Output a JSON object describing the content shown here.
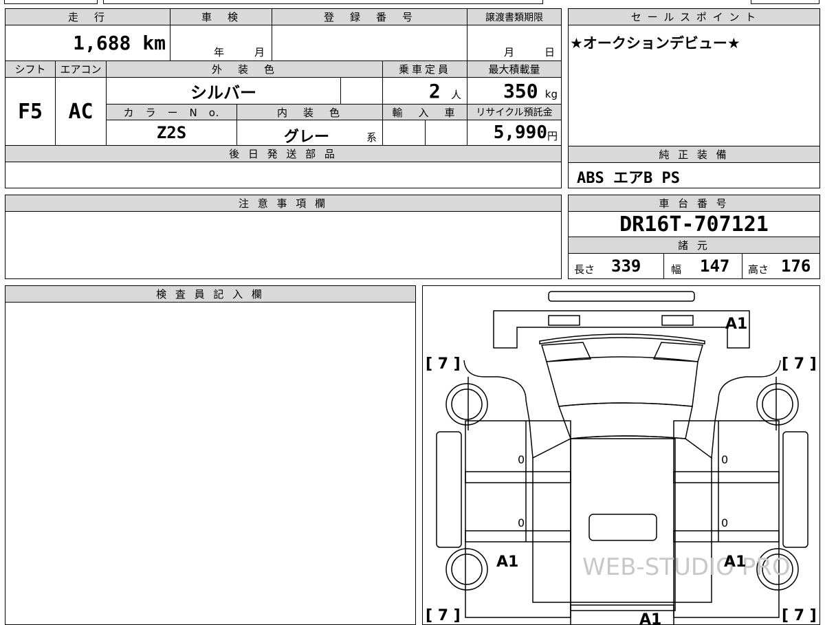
{
  "headers": {
    "mileage": "走　行",
    "inspection": "車　検",
    "registration": "登　録　番　号",
    "transfer_deadline": "譲渡書類期限",
    "sales_point": "セ ー ル ス ポ イ ン ト",
    "shift": "シフト",
    "aircon": "エアコン",
    "exterior_color": "外　装　色",
    "capacity": "乗車定員",
    "max_load": "最大積載量",
    "color_no": "カ　ラ　ー　N　o.",
    "interior_color": "内　装　色",
    "import": "輸　入　車",
    "recycle_fee": "リサイクル預託金",
    "later_parts": "後 日 発 送 部 品",
    "genuine_equipment": "純 正 装 備",
    "notes": "注 意 事 項 欄",
    "chassis_no": "車 台 番 号",
    "specs": "諸 元",
    "inspector": "検 査 員 記 入 欄"
  },
  "values": {
    "mileage": "1,688",
    "mileage_unit": "km",
    "year_label": "年",
    "month_label": "月",
    "deadline_month": "月",
    "deadline_day": "日",
    "sales_point": "★オークションデビュー★",
    "shift": "F5",
    "aircon": "AC",
    "exterior_color": "シルバー",
    "capacity": "2",
    "capacity_unit": "人",
    "max_load": "350",
    "max_load_unit": "kg",
    "color_no": "Z2S",
    "interior_color": "グレー",
    "interior_suffix": "系",
    "recycle_fee": "5,990",
    "recycle_unit": "円",
    "genuine_equipment": "ABS エアB PS",
    "chassis_no": "DR16T-707121",
    "length_label": "長さ",
    "length": "339",
    "width_label": "幅",
    "width": "147",
    "height_label": "高さ",
    "height": "176"
  },
  "diagram": {
    "labels": {
      "rear_bumper": "A1",
      "left_front_wheel": "[ 7 ]",
      "right_front_wheel": "[ 7 ]",
      "left_door_front": "0",
      "right_door_front": "0",
      "left_door_rear": "0",
      "right_door_rear": "0",
      "left_rear_fender": "A1",
      "right_rear_fender": "A1",
      "left_rear_wheel": "[ 7 ]",
      "right_rear_wheel": "[ 7 ]",
      "bed": "A1"
    },
    "watermark": "WEB-STUDIO PRO"
  }
}
